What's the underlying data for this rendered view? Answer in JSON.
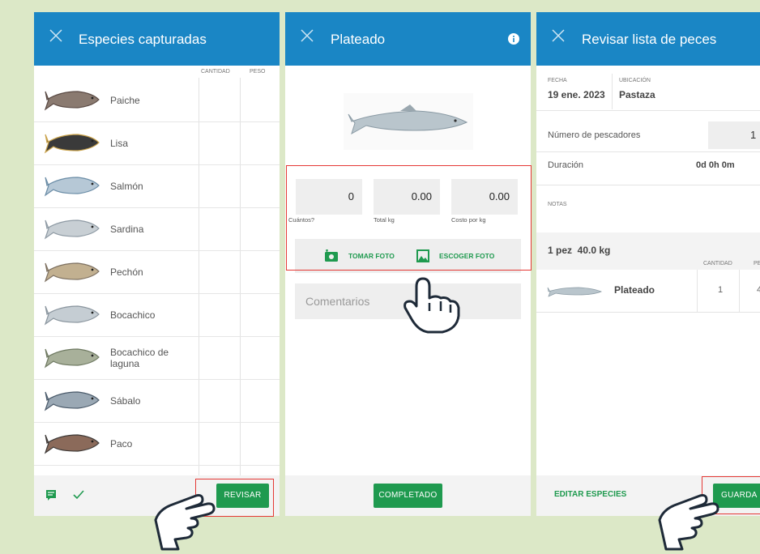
{
  "screen1": {
    "title": "Especies capturadas",
    "col_cantidad": "CANTIDAD",
    "col_peso": "PESO",
    "species": [
      {
        "name": "Paiche"
      },
      {
        "name": "Lisa"
      },
      {
        "name": "Salmón"
      },
      {
        "name": "Sardina"
      },
      {
        "name": "Pechón"
      },
      {
        "name": "Bocachico"
      },
      {
        "name": "Bocachico de laguna"
      },
      {
        "name": "Sábalo"
      },
      {
        "name": "Paco"
      }
    ],
    "review_button": "REVISAR"
  },
  "screen2": {
    "title": "Plateado",
    "cuantos_value": "0",
    "cuantos_label": "Cuántos?",
    "total_value": "0.00",
    "total_label": "Total kg",
    "costo_value": "0.00",
    "costo_label": "Costo por kg",
    "take_photo": "TOMAR FOTO",
    "choose_photo": "ESCOGER FOTO",
    "comments_placeholder": "Comentarios",
    "done_button": "COMPLETADO"
  },
  "screen3": {
    "title": "Revisar lista de peces",
    "fecha_label": "FECHA",
    "fecha_value": "19 ene. 2023",
    "ubicacion_label": "UBICACIÓN",
    "ubicacion_value": "Pastaza",
    "pescadores_label": "Número de pescadores",
    "pescadores_value": "1",
    "duracion_label": "Duración",
    "duracion_value": "0d 0h 0m",
    "notas_label": "NOTAS",
    "summary": "1 pez  40.0 kg",
    "col_cantidad": "CANTIDAD",
    "col_peso": "PE",
    "fish_name": "Plateado",
    "fish_qty": "1",
    "fish_weight": "4",
    "edit_species": "EDITAR ESPECIES",
    "save_button": "GUARDA"
  },
  "colors": {
    "primary": "#1a86c5",
    "accent": "#1f9a4f",
    "highlight": "#e53935",
    "background": "#dce8c7"
  }
}
